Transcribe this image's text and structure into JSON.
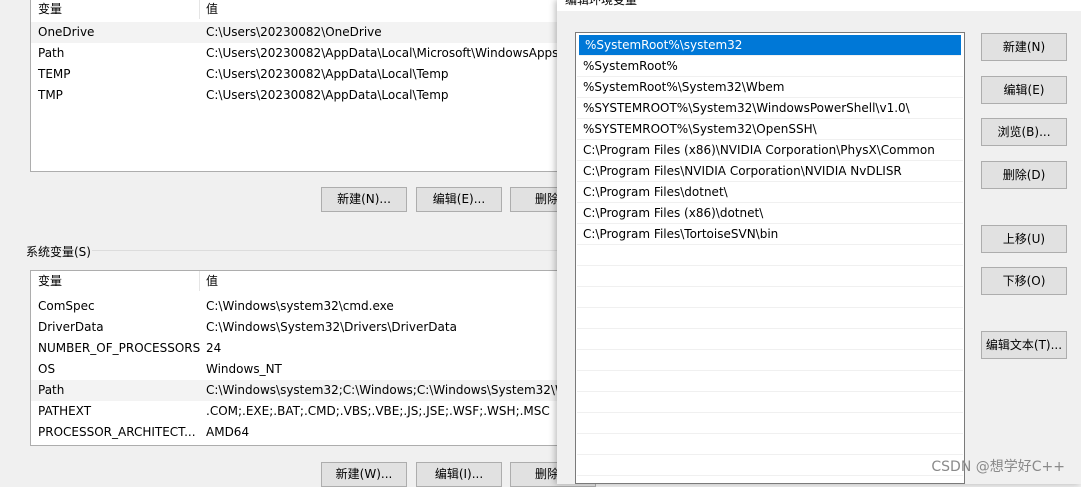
{
  "user_vars": {
    "headers": [
      "变量",
      "值"
    ],
    "rows": [
      {
        "name": "OneDrive",
        "value": "C:\\Users\\20230082\\OneDrive"
      },
      {
        "name": "Path",
        "value": "C:\\Users\\20230082\\AppData\\Local\\Microsoft\\WindowsApps"
      },
      {
        "name": "TEMP",
        "value": "C:\\Users\\20230082\\AppData\\Local\\Temp"
      },
      {
        "name": "TMP",
        "value": "C:\\Users\\20230082\\AppData\\Local\\Temp"
      }
    ],
    "buttons": {
      "new": "新建(N)...",
      "edit": "编辑(E)...",
      "delete": "删除"
    }
  },
  "system_vars": {
    "group_label": "系统变量(S)",
    "headers": [
      "变量",
      "值"
    ],
    "rows": [
      {
        "name": "ComSpec",
        "value": "C:\\Windows\\system32\\cmd.exe"
      },
      {
        "name": "DriverData",
        "value": "C:\\Windows\\System32\\Drivers\\DriverData"
      },
      {
        "name": "NUMBER_OF_PROCESSORS",
        "value": "24"
      },
      {
        "name": "OS",
        "value": "Windows_NT"
      },
      {
        "name": "Path",
        "value": "C:\\Windows\\system32;C:\\Windows;C:\\Windows\\System32\\W"
      },
      {
        "name": "PATHEXT",
        "value": ".COM;.EXE;.BAT;.CMD;.VBS;.VBE;.JS;.JSE;.WSF;.WSH;.MSC"
      },
      {
        "name": "PROCESSOR_ARCHITECT...",
        "value": "AMD64"
      }
    ],
    "buttons": {
      "new": "新建(W)...",
      "edit": "编辑(I)...",
      "delete": "删除"
    }
  },
  "edit_dialog": {
    "title": "编辑环境变量",
    "paths": [
      "%SystemRoot%\\system32",
      "%SystemRoot%",
      "%SystemRoot%\\System32\\Wbem",
      "%SYSTEMROOT%\\System32\\WindowsPowerShell\\v1.0\\",
      "%SYSTEMROOT%\\System32\\OpenSSH\\",
      "C:\\Program Files (x86)\\NVIDIA Corporation\\PhysX\\Common",
      "C:\\Program Files\\NVIDIA Corporation\\NVIDIA NvDLISR",
      "C:\\Program Files\\dotnet\\",
      "C:\\Program Files (x86)\\dotnet\\",
      "C:\\Program Files\\TortoiseSVN\\bin"
    ],
    "selected_index": 0,
    "buttons": {
      "new": "新建(N)",
      "edit": "编辑(E)",
      "browse": "浏览(B)...",
      "delete": "删除(D)",
      "move_up": "上移(U)",
      "move_down": "下移(O)",
      "edit_text": "编辑文本(T)..."
    }
  },
  "watermark": "CSDN @想学好C++",
  "colors": {
    "selection": "#0078d7",
    "window_bg": "#f0f0f0"
  }
}
